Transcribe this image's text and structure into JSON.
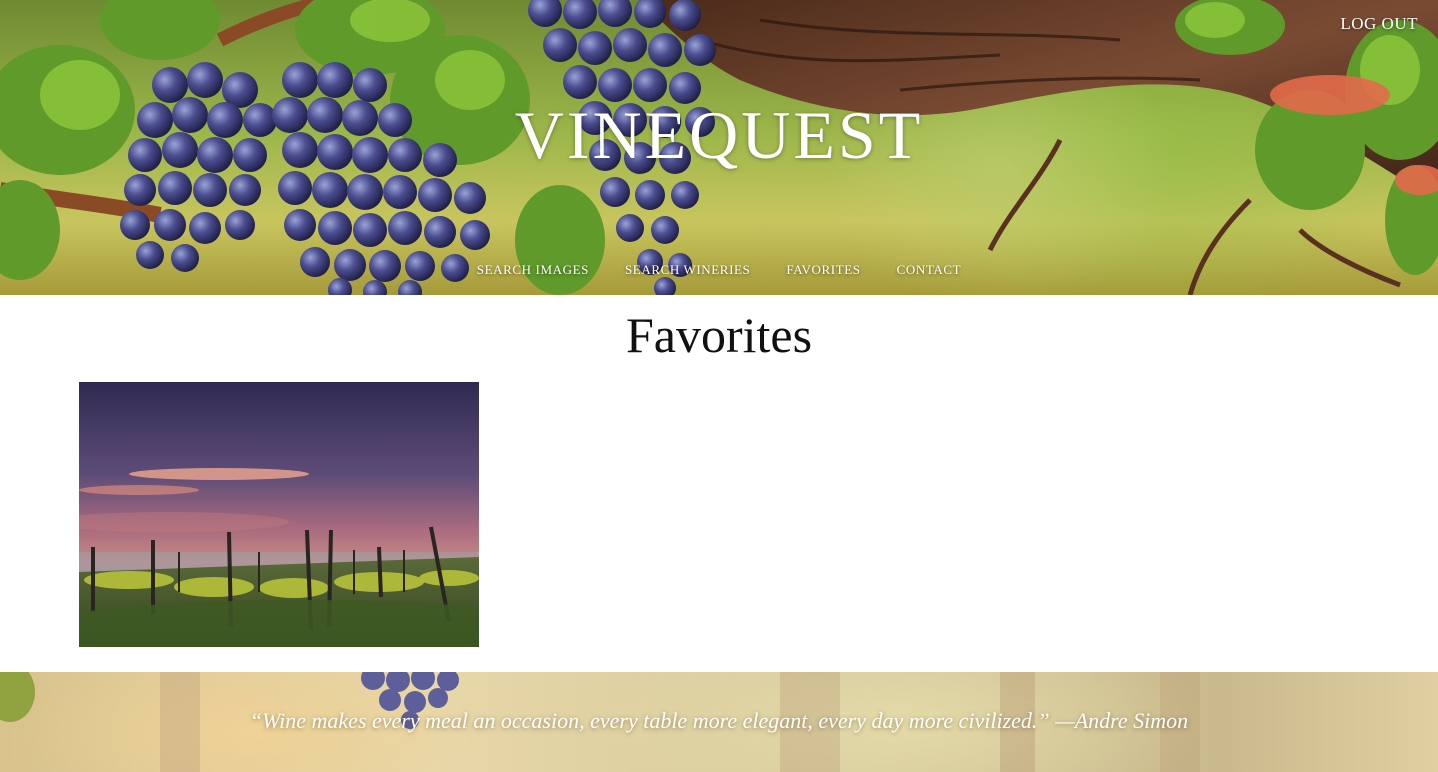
{
  "header": {
    "site_title": "VINEQUEST",
    "logout_label": "LOG OUT",
    "hero_image": "grapes-on-vine-photo",
    "nav": [
      {
        "label": "SEARCH IMAGES"
      },
      {
        "label": "SEARCH WINERIES"
      },
      {
        "label": "FAVORITES"
      },
      {
        "label": "CONTACT"
      }
    ]
  },
  "main": {
    "page_title": "Favorites",
    "favorites": [
      {
        "image": "vineyard-at-dusk-photo"
      }
    ]
  },
  "footer": {
    "quote": "“Wine makes every meal an occasion, every table more elegant, every day more civilized.” —Andre Simon",
    "background_image": "blurred-vineyard-photo"
  },
  "colors": {
    "text_light": "#ffffff",
    "text_dark": "#111111",
    "background": "#ffffff"
  }
}
